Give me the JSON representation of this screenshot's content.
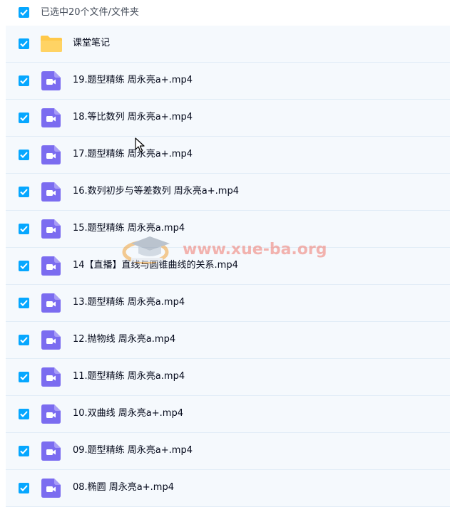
{
  "header": {
    "selection_label": "已选中20个文件/文件夹"
  },
  "items": [
    {
      "type": "folder",
      "name": "课堂笔记"
    },
    {
      "type": "video",
      "name": "19.题型精练 周永亮a+.mp4"
    },
    {
      "type": "video",
      "name": "18.等比数列 周永亮a+.mp4"
    },
    {
      "type": "video",
      "name": "17.题型精练 周永亮a+.mp4"
    },
    {
      "type": "video",
      "name": "16.数列初步与等差数列 周永亮a+.mp4"
    },
    {
      "type": "video",
      "name": "15.题型精练 周永亮a.mp4"
    },
    {
      "type": "video",
      "name": "14【直播】直线与圆锥曲线的关系.mp4"
    },
    {
      "type": "video",
      "name": "13.题型精练 周永亮a.mp4"
    },
    {
      "type": "video",
      "name": "12.抛物线 周永亮a.mp4"
    },
    {
      "type": "video",
      "name": "11.题型精练 周永亮a.mp4"
    },
    {
      "type": "video",
      "name": "10.双曲线 周永亮a+.mp4"
    },
    {
      "type": "video",
      "name": "09.题型精练 周永亮a+.mp4"
    },
    {
      "type": "video",
      "name": "08.椭圆 周永亮a+.mp4"
    }
  ],
  "watermark": {
    "text": "www.xue-ba.org"
  },
  "colors": {
    "checkbox": "#06a7ff",
    "row_bg": "#f5f9fd",
    "video_icon": "#7b6cf0",
    "folder_icon": "#ffc94a"
  }
}
